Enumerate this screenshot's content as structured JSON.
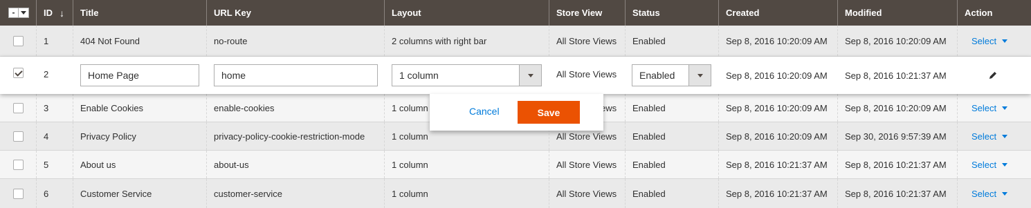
{
  "header": {
    "mass_select_dash": "-",
    "columns": [
      "ID",
      "Title",
      "URL Key",
      "Layout",
      "Store View",
      "Status",
      "Created",
      "Modified",
      "Action"
    ],
    "sort_indicator": "↓"
  },
  "rows": [
    {
      "id": "1",
      "title": "404 Not Found",
      "url_key": "no-route",
      "layout": "2 columns with right bar",
      "store_view": "All Store Views",
      "status": "Enabled",
      "created": "Sep 8, 2016 10:20:09 AM",
      "modified": "Sep 8, 2016 10:20:09 AM",
      "action": "Select",
      "checked": false
    },
    {
      "id": "2",
      "title": "Home Page",
      "url_key": "home",
      "layout": "1 column",
      "store_view": "All Store Views",
      "status": "Enabled",
      "created": "Sep 8, 2016 10:20:09 AM",
      "modified": "Sep 8, 2016 10:21:37 AM",
      "action": "",
      "checked": true,
      "editing": true
    },
    {
      "id": "3",
      "title": "Enable Cookies",
      "url_key": "enable-cookies",
      "layout": "1 column",
      "store_view": "All Store Views",
      "status": "Enabled",
      "created": "Sep 8, 2016 10:20:09 AM",
      "modified": "Sep 8, 2016 10:20:09 AM",
      "action": "Select",
      "checked": false
    },
    {
      "id": "4",
      "title": "Privacy Policy",
      "url_key": "privacy-policy-cookie-restriction-mode",
      "layout": "1 column",
      "store_view": "All Store Views",
      "status": "Enabled",
      "created": "Sep 8, 2016 10:20:09 AM",
      "modified": "Sep 30, 2016 9:57:39 AM",
      "action": "Select",
      "checked": false
    },
    {
      "id": "5",
      "title": "About us",
      "url_key": "about-us",
      "layout": "1 column",
      "store_view": "All Store Views",
      "status": "Enabled",
      "created": "Sep 8, 2016 10:21:37 AM",
      "modified": "Sep 8, 2016 10:21:37 AM",
      "action": "Select",
      "checked": false
    },
    {
      "id": "6",
      "title": "Customer Service",
      "url_key": "customer-service",
      "layout": "1 column",
      "store_view": "All Store Views",
      "status": "Enabled",
      "created": "Sep 8, 2016 10:21:37 AM",
      "modified": "Sep 8, 2016 10:21:37 AM",
      "action": "Select",
      "checked": false
    }
  ],
  "edit_popup": {
    "cancel_label": "Cancel",
    "save_label": "Save"
  },
  "colors": {
    "header_bg": "#514943",
    "link": "#007bdb",
    "save_bg": "#eb5202"
  },
  "icons": {
    "edit": "pencil-icon",
    "action_caret": "caret-down-icon"
  }
}
